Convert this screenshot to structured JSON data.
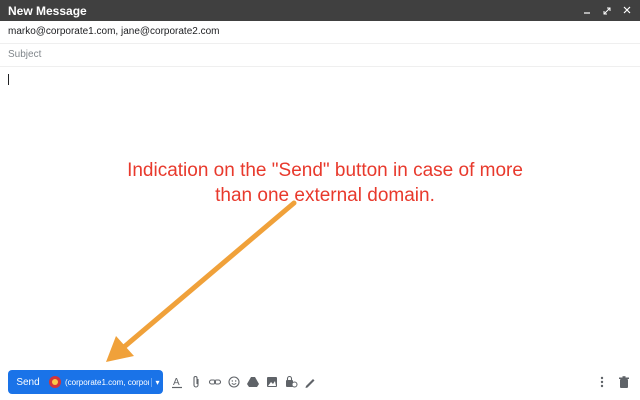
{
  "window": {
    "title": "New Message",
    "controls": [
      "minimize-icon",
      "expand-icon",
      "close-icon"
    ]
  },
  "recipients": {
    "to_value": "marko@corporate1.com, jane@corporate2.com"
  },
  "subject": {
    "placeholder": "Subject"
  },
  "annotation": {
    "line1": "Indication on the \"Send\" button in case of more",
    "line2": "than one external domain.",
    "color": "#e8392c",
    "arrow_color": "#f0a13a"
  },
  "send_button": {
    "label": "Send",
    "domains_label": "(corporate1.com, corporate",
    "color": "#1a73e8"
  },
  "toolbar": {
    "icons": [
      "format-text-icon",
      "attach-icon",
      "link-icon",
      "emoji-icon",
      "drive-icon",
      "photo-icon",
      "confidential-icon",
      "signature-icon"
    ],
    "right_icons": [
      "more-options-icon",
      "delete-icon"
    ]
  }
}
